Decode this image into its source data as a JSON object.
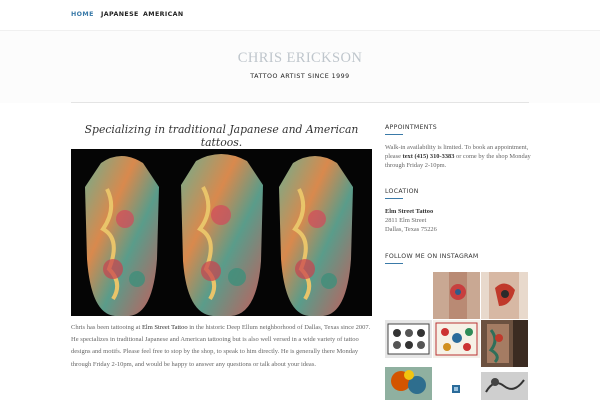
{
  "nav": {
    "items": [
      "HOME",
      "JAPANESE",
      "AMERICAN"
    ]
  },
  "site": {
    "title": "CHRIS ERICKSON",
    "tagline": "TATTOO ARTIST SINCE 1999"
  },
  "main": {
    "headline": "Specializing in traditional Japanese and American tattoos.",
    "intro": {
      "pre": "Chris has been tattooing at ",
      "link": "Elm Street Tattoo",
      "post": " in the historic Deep Ellum neighborhood of Dallas, Texas since 2007. He specializes in traditional Japanese and American tattooing but is also well versed in a wide variety of tattoo designs and motifs. Please feel free to stop by the shop, to speak to him directly. He is generally there Monday through Friday 2-10pm, and would be happy to answer any questions or talk about your ideas."
    }
  },
  "sidebar": {
    "appointments": {
      "heading": "APPOINTMENTS",
      "pre": "Walk-in availability is limited. To book an appointment, please ",
      "contact": "text (415) 310-3383",
      "post": " or come by the shop Monday through Friday 2-10pm."
    },
    "location": {
      "heading": "LOCATION",
      "shop": "Elm Street Tattoo",
      "street": "2811 Elm Street",
      "city": "Dallas, Texas 75226"
    },
    "instagram": {
      "heading": "FOLLOW ME ON INSTAGRAM"
    }
  },
  "colors": {
    "accent": "#3a7aa8",
    "nav_text": "#222222",
    "site_title": "#bfc6cc"
  }
}
